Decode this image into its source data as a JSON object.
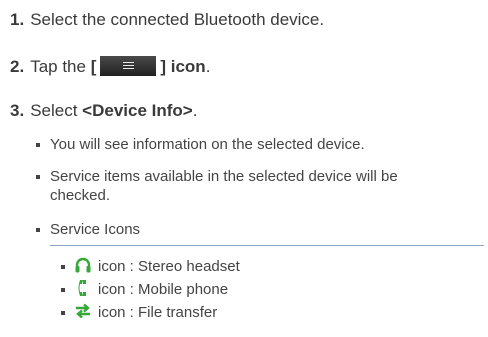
{
  "steps": [
    {
      "num": "1.",
      "text": "Select the connected Bluetooth device."
    },
    {
      "num": "2.",
      "pre": "Tap the ",
      "bracket_open": "[",
      "bracket_close": "] icon",
      "post": "."
    },
    {
      "num": "3.",
      "pre": "Select ",
      "bold": "<Device Info>",
      "post": "."
    }
  ],
  "bullets": [
    "You will see information on the selected device.",
    "Service items available in the selected device will be",
    "checked.",
    "Service Icons"
  ],
  "service_icons": [
    {
      "icon": "headset-icon",
      "text": "icon : Stereo headset",
      "color": "#35a838"
    },
    {
      "icon": "phone-icon",
      "text": "icon : Mobile phone",
      "color": "#35a838"
    },
    {
      "icon": "file-transfer-icon",
      "text": "icon : File transfer",
      "color": "#35a838"
    }
  ],
  "colors": {
    "divider": "#8fa6c4",
    "text": "#3a3a3a",
    "icon_green": "#35a838"
  }
}
